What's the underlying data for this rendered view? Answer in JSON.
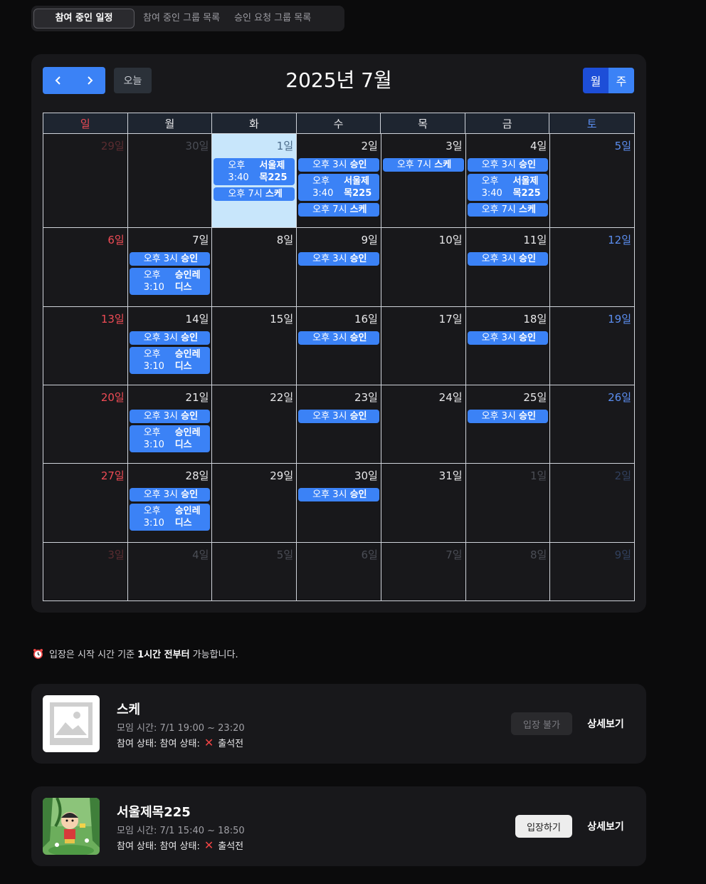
{
  "tabs": [
    {
      "label": "참여 중인 일정",
      "active": true
    },
    {
      "label": "참여 중인 그룹 목록",
      "active": false
    },
    {
      "label": "승인 요청 그룹 목록",
      "active": false
    }
  ],
  "calendar": {
    "title": "2025년 7월",
    "today_label": "오늘",
    "view_month": "월",
    "view_week": "주",
    "weekdays": [
      "일",
      "월",
      "화",
      "수",
      "목",
      "금",
      "토"
    ],
    "weeks": [
      {
        "row_height": 132,
        "days": [
          {
            "label": "29일",
            "other": true,
            "events": []
          },
          {
            "label": "30일",
            "other": true,
            "events": []
          },
          {
            "label": "1일",
            "today": true,
            "events": [
              {
                "time": "오후 3:40",
                "title": "서울제목225",
                "two_line": true,
                "time1": "오후",
                "time2": "3:40",
                "title1": "서울제",
                "title2": "목225"
              },
              {
                "time": "오후 7시",
                "title": "스케"
              }
            ]
          },
          {
            "label": "2일",
            "events": [
              {
                "time": "오후 3시",
                "title": "승인"
              },
              {
                "time": "오후 3:40",
                "title": "서울제목225",
                "two_line": true,
                "time1": "오후",
                "time2": "3:40",
                "title1": "서울제",
                "title2": "목225"
              },
              {
                "time": "오후 7시",
                "title": "스케"
              }
            ]
          },
          {
            "label": "3일",
            "events": [
              {
                "time": "오후 7시",
                "title": "스케"
              }
            ]
          },
          {
            "label": "4일",
            "events": [
              {
                "time": "오후 3시",
                "title": "승인"
              },
              {
                "time": "오후 3:40",
                "title": "서울제목225",
                "two_line": true,
                "time1": "오후",
                "time2": "3:40",
                "title1": "서울제",
                "title2": "목225"
              },
              {
                "time": "오후 7시",
                "title": "스케"
              }
            ]
          },
          {
            "label": "5일",
            "events": []
          }
        ]
      },
      {
        "row_height": 111,
        "days": [
          {
            "label": "6일",
            "events": []
          },
          {
            "label": "7일",
            "events": [
              {
                "time": "오후 3시",
                "title": "승인"
              },
              {
                "time": "오후 3:10",
                "title": "승인레디스",
                "two_line": true,
                "time1": "오후",
                "time2": "3:10",
                "title1": "승인레",
                "title2": "디스"
              }
            ]
          },
          {
            "label": "8일",
            "events": []
          },
          {
            "label": "9일",
            "events": [
              {
                "time": "오후 3시",
                "title": "승인"
              }
            ]
          },
          {
            "label": "10일",
            "events": []
          },
          {
            "label": "11일",
            "events": [
              {
                "time": "오후 3시",
                "title": "승인"
              }
            ]
          },
          {
            "label": "12일",
            "events": []
          }
        ]
      },
      {
        "row_height": 110,
        "days": [
          {
            "label": "13일",
            "events": []
          },
          {
            "label": "14일",
            "events": [
              {
                "time": "오후 3시",
                "title": "승인"
              },
              {
                "time": "오후 3:10",
                "title": "승인레디스",
                "two_line": true,
                "time1": "오후",
                "time2": "3:10",
                "title1": "승인레",
                "title2": "디스"
              }
            ]
          },
          {
            "label": "15일",
            "events": []
          },
          {
            "label": "16일",
            "events": [
              {
                "time": "오후 3시",
                "title": "승인"
              }
            ]
          },
          {
            "label": "17일",
            "events": []
          },
          {
            "label": "18일",
            "events": [
              {
                "time": "오후 3시",
                "title": "승인"
              }
            ]
          },
          {
            "label": "19일",
            "events": []
          }
        ]
      },
      {
        "row_height": 110,
        "days": [
          {
            "label": "20일",
            "events": []
          },
          {
            "label": "21일",
            "events": [
              {
                "time": "오후 3시",
                "title": "승인"
              },
              {
                "time": "오후 3:10",
                "title": "승인레디스",
                "two_line": true,
                "time1": "오후",
                "time2": "3:10",
                "title1": "승인레",
                "title2": "디스"
              }
            ]
          },
          {
            "label": "22일",
            "events": []
          },
          {
            "label": "23일",
            "events": [
              {
                "time": "오후 3시",
                "title": "승인"
              }
            ]
          },
          {
            "label": "24일",
            "events": []
          },
          {
            "label": "25일",
            "events": [
              {
                "time": "오후 3시",
                "title": "승인"
              }
            ]
          },
          {
            "label": "26일",
            "events": []
          }
        ]
      },
      {
        "row_height": 111,
        "days": [
          {
            "label": "27일",
            "events": []
          },
          {
            "label": "28일",
            "events": [
              {
                "time": "오후 3시",
                "title": "승인"
              },
              {
                "time": "오후 3:10",
                "title": "승인레디스",
                "two_line": true,
                "time1": "오후",
                "time2": "3:10",
                "title1": "승인레",
                "title2": "디스"
              }
            ]
          },
          {
            "label": "29일",
            "events": []
          },
          {
            "label": "30일",
            "events": [
              {
                "time": "오후 3시",
                "title": "승인"
              }
            ]
          },
          {
            "label": "31일",
            "events": []
          },
          {
            "label": "1일",
            "other": true,
            "events": []
          },
          {
            "label": "2일",
            "other": true,
            "events": []
          }
        ]
      },
      {
        "row_height": 82,
        "days": [
          {
            "label": "3일",
            "other": true,
            "events": []
          },
          {
            "label": "4일",
            "other": true,
            "events": []
          },
          {
            "label": "5일",
            "other": true,
            "events": []
          },
          {
            "label": "6일",
            "other": true,
            "events": []
          },
          {
            "label": "7일",
            "other": true,
            "events": []
          },
          {
            "label": "8일",
            "other": true,
            "events": []
          },
          {
            "label": "9일",
            "other": true,
            "events": []
          }
        ]
      }
    ]
  },
  "notice": {
    "icon": "alarm-clock-icon",
    "prefix": "입장은 시작 시간 기준 ",
    "bold": "1시간 전부터",
    "suffix": " 가능합니다."
  },
  "meetings": [
    {
      "title": "스케",
      "time": "모임 시간: 7/1 19:00 ~ 23:20",
      "status_label": "참여 상태: 참여 상태:",
      "status_value": "출석전",
      "enter_label": "입장 불가",
      "enter_enabled": false,
      "detail_label": "상세보기",
      "thumbnail": "placeholder-image-icon"
    },
    {
      "title": "서울제목225",
      "time": "모임 시간: 7/1 15:40 ~ 18:50",
      "status_label": "참여 상태: 참여 상태:",
      "status_value": "출석전",
      "enter_label": "입장하기",
      "enter_enabled": true,
      "detail_label": "상세보기",
      "thumbnail": "cartoon-character-image"
    }
  ]
}
